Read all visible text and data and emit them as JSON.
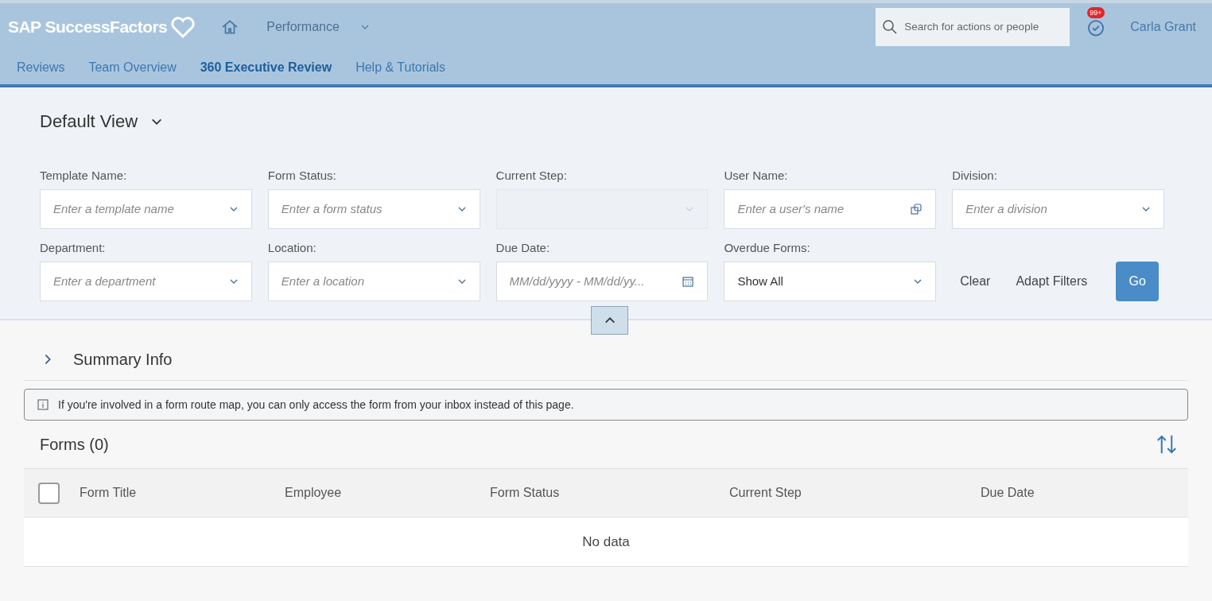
{
  "header": {
    "logo": "SAP SuccessFactors",
    "module": "Performance",
    "search": {
      "placeholder": "Search for actions or people"
    },
    "notification_badge": "99+",
    "user": "Carla Grant"
  },
  "tabs": [
    {
      "label": "Reviews",
      "selected": false
    },
    {
      "label": "Team Overview",
      "selected": false
    },
    {
      "label": "360 Executive Review",
      "selected": true
    },
    {
      "label": "Help & Tutorials",
      "selected": false
    }
  ],
  "view": {
    "title": "Default View"
  },
  "filters": [
    {
      "label": "Template Name:",
      "kind": "combo",
      "placeholder": "Enter a template name",
      "disabled": false
    },
    {
      "label": "Form Status:",
      "kind": "combo",
      "placeholder": "Enter a form status",
      "disabled": false
    },
    {
      "label": "Current Step:",
      "kind": "combo",
      "disabled": true
    },
    {
      "label": "User Name:",
      "kind": "valuehelp",
      "placeholder": "Enter a user's name",
      "disabled": false
    },
    {
      "label": "Division:",
      "kind": "combo",
      "placeholder": "Enter a division",
      "disabled": false
    },
    {
      "label": "Department:",
      "kind": "combo",
      "placeholder": "Enter a department",
      "disabled": false
    },
    {
      "label": "Location:",
      "kind": "combo",
      "placeholder": "Enter a location",
      "disabled": false
    },
    {
      "label": "Due Date:",
      "kind": "date",
      "placeholder": "MM/dd/yyyy - MM/dd/yy...",
      "disabled": false
    },
    {
      "label": "Overdue Forms:",
      "kind": "combo",
      "value": "Show All",
      "disabled": false
    }
  ],
  "filter_buttons": [
    {
      "label": "Clear",
      "kind": "text"
    },
    {
      "label": "Adapt Filters",
      "kind": "text"
    },
    {
      "label": "Go",
      "kind": "primary"
    }
  ],
  "summary": {
    "title": "Summary Info",
    "expanded": false
  },
  "info_message": "If you're involved in a form route map, you can only access the form from your inbox instead of this page.",
  "table": {
    "title": "Forms (0)",
    "select_all_checked": false,
    "columns": [
      "Form Title",
      "Employee",
      "Form Status",
      "Current Step",
      "Due Date"
    ],
    "empty_text": "No data"
  }
}
